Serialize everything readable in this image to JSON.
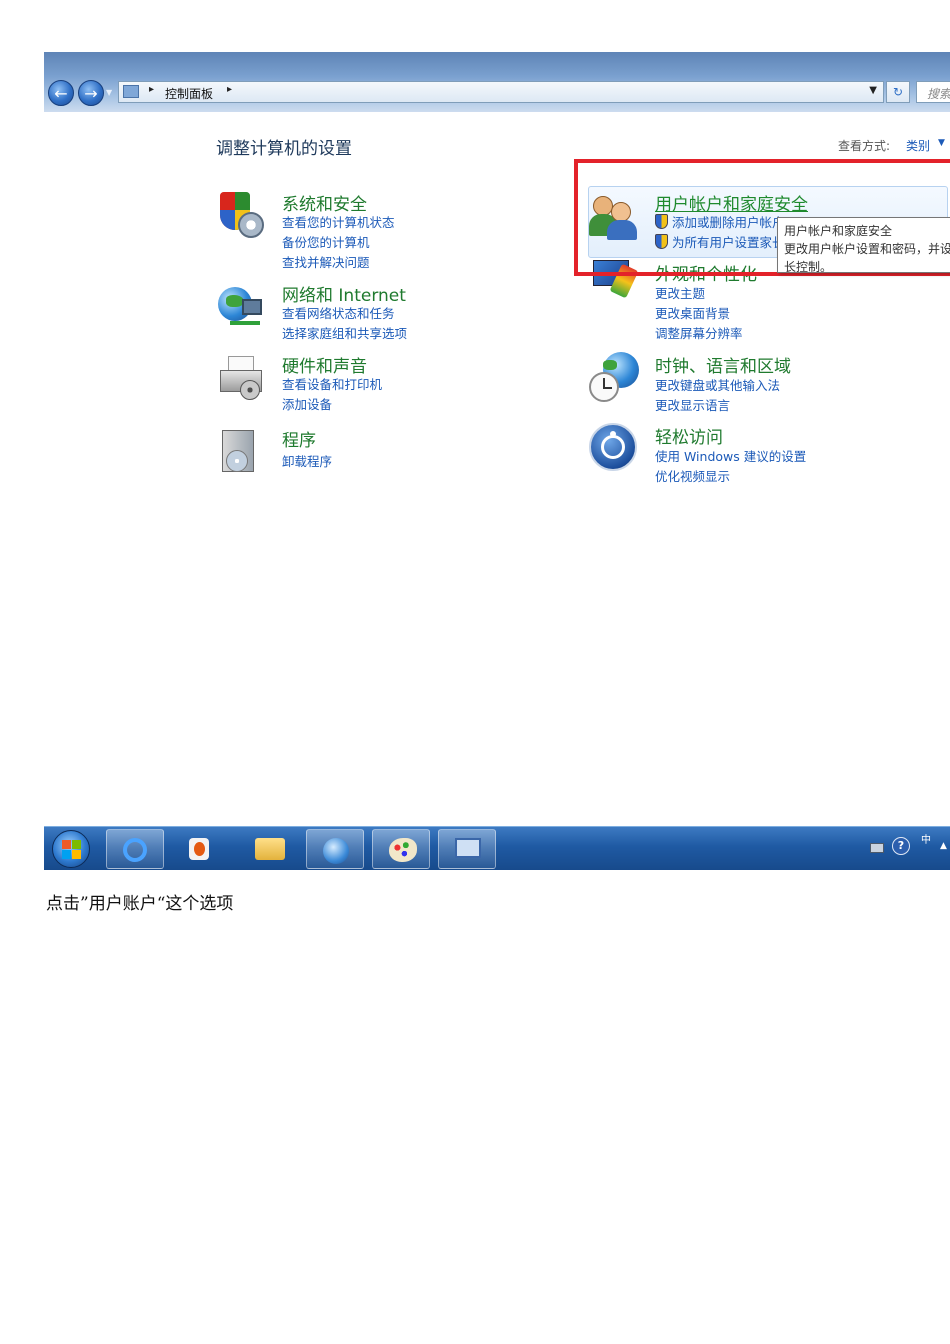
{
  "address_bar": {
    "breadcrumb": "控制面板",
    "separator": "▸",
    "search_placeholder": "搜索"
  },
  "header": {
    "title": "调整计算机的设置",
    "view_label": "查看方式:",
    "view_value": "类别"
  },
  "categories": {
    "security": {
      "title": "系统和安全",
      "links": [
        "查看您的计算机状态",
        "备份您的计算机",
        "查找并解决问题"
      ]
    },
    "network": {
      "title": "网络和 Internet",
      "links": [
        "查看网络状态和任务",
        "选择家庭组和共享选项"
      ]
    },
    "hardware": {
      "title": "硬件和声音",
      "links": [
        "查看设备和打印机",
        "添加设备"
      ]
    },
    "programs": {
      "title": "程序",
      "links": [
        "卸载程序"
      ]
    },
    "users": {
      "title": "用户帐户和家庭安全",
      "links": [
        "添加或删除用户帐户",
        "为所有用户设置家长控制"
      ]
    },
    "appearance": {
      "title": "外观和个性化",
      "links": [
        "更改主题",
        "更改桌面背景",
        "调整屏幕分辨率"
      ]
    },
    "clock": {
      "title": "时钟、语言和区域",
      "links": [
        "更改键盘或其他输入法",
        "更改显示语言"
      ]
    },
    "access": {
      "title": "轻松访问",
      "links": [
        "使用 Windows 建议的设置",
        "优化视频显示"
      ]
    }
  },
  "tooltip": {
    "line1": "用户帐户和家庭安全",
    "line2": "更改用户帐户设置和密码，并设置家",
    "line3": "长控制。"
  },
  "colors": {
    "highlight_box": "#e3222a",
    "category_title": "#1f7a2e",
    "link": "#1c5ab8",
    "taskbar": "#1f5aa3"
  },
  "taskbar": {
    "apps": [
      "internet-explorer-icon",
      "media-player-icon",
      "file-explorer-icon",
      "network-globe-icon",
      "paint-icon",
      "control-panel-icon"
    ],
    "help_label": "?",
    "lang_label": "中"
  },
  "caption": "点击”用户账户“这个选项"
}
